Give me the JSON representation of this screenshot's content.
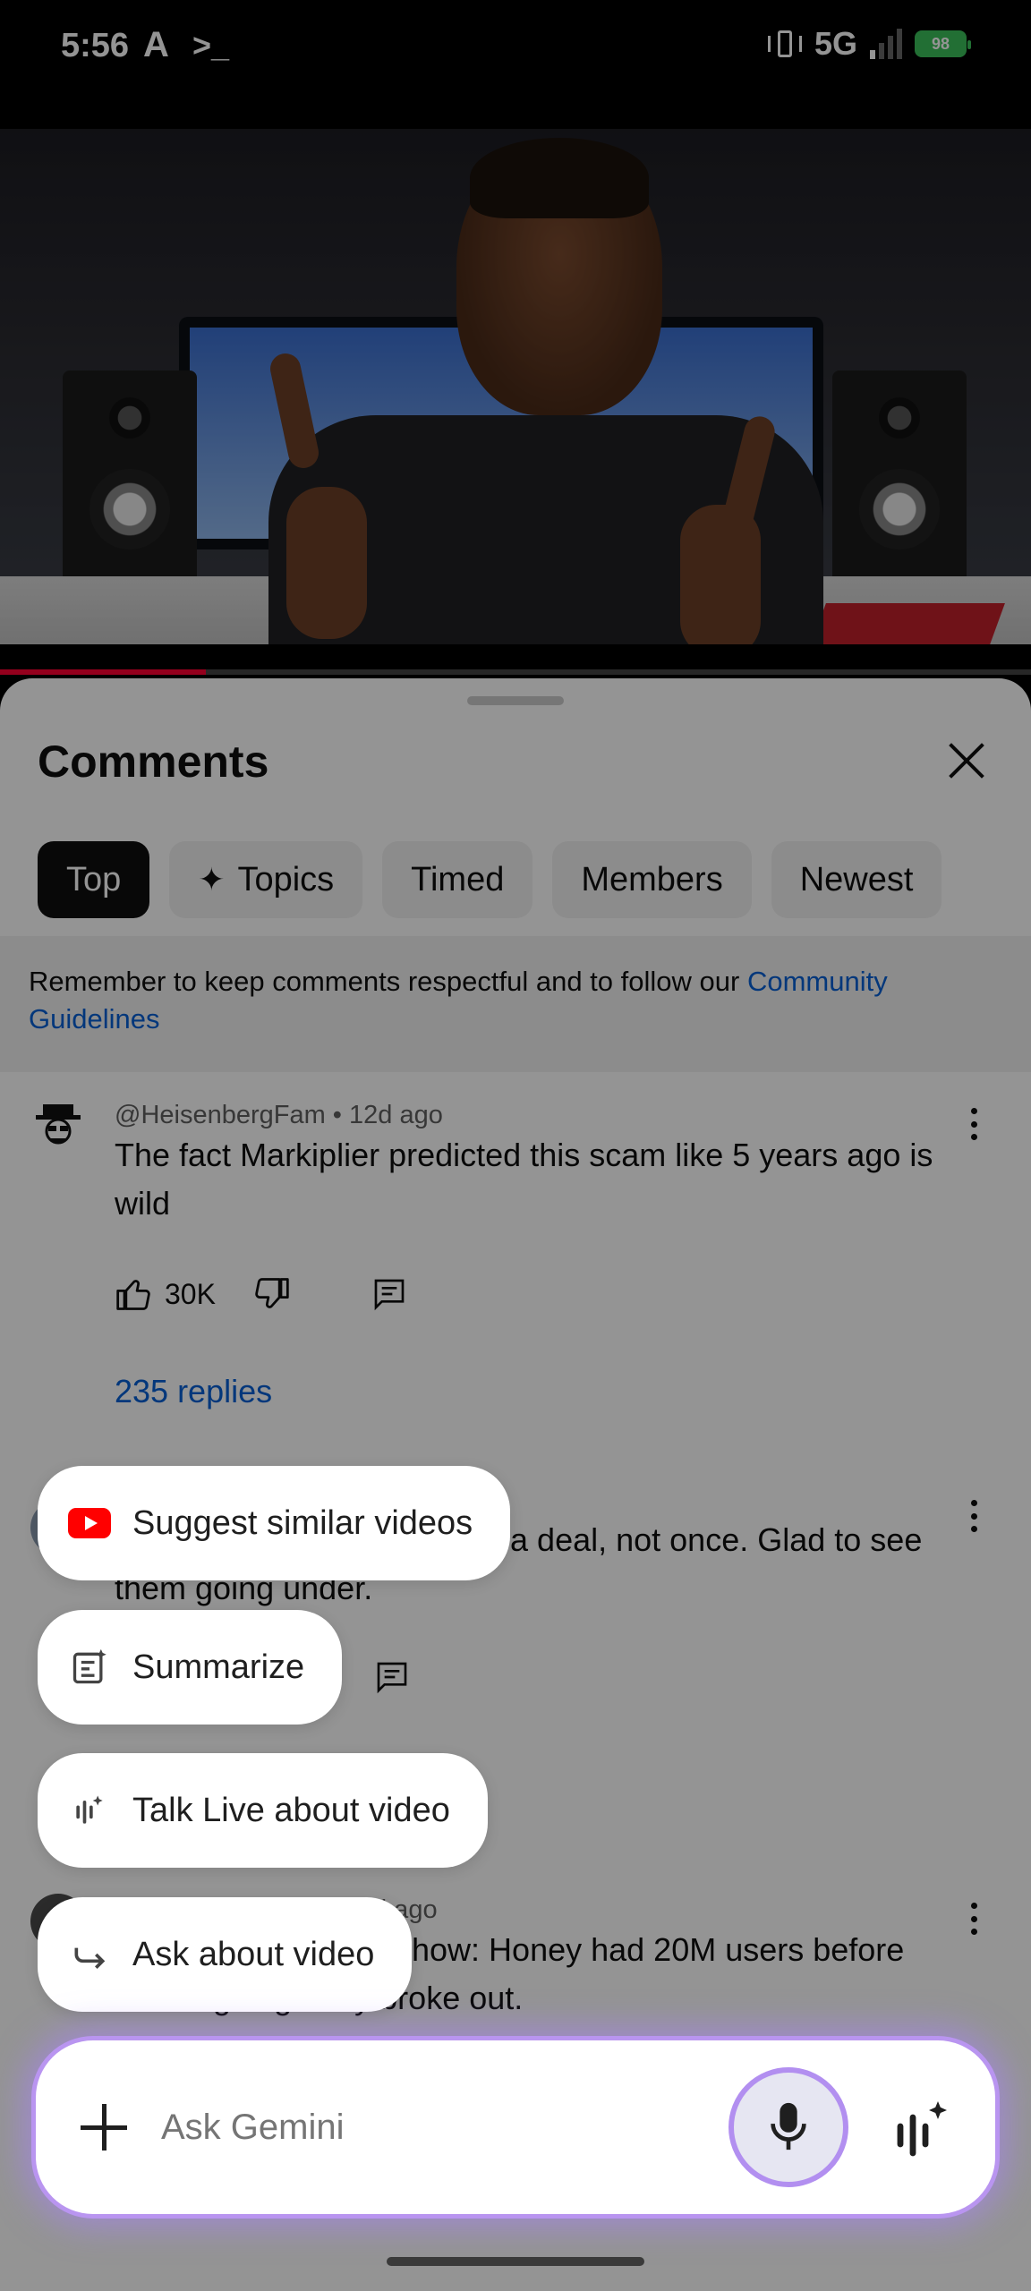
{
  "status_bar": {
    "time": "5:56",
    "network": "5G",
    "battery": "98"
  },
  "video": {
    "progress_fraction": 0.2
  },
  "comments_panel": {
    "title": "Comments",
    "filter_chips": [
      {
        "label": "Top",
        "active": true
      },
      {
        "label": "Topics",
        "active": false,
        "icon": "sparkle-icon"
      },
      {
        "label": "Timed",
        "active": false
      },
      {
        "label": "Members",
        "active": false
      },
      {
        "label": "Newest",
        "active": false
      }
    ],
    "notice": {
      "text": "Remember to keep comments respectful and to follow our ",
      "link": "Community Guidelines"
    },
    "comments": [
      {
        "author": "@HeisenbergFam",
        "age": "12d ago",
        "meta": "@HeisenbergFam • 12d ago",
        "text": "The fact Markiplier predicted this scam like 5 years ago is wild",
        "likes": "30K",
        "replies": "235 replies"
      },
      {
        "text_fragment_1": "e a deal, not once. Glad to see",
        "text_fragment_2": "them going under."
      },
      {
        "meta_fragment": "d ago",
        "text_fragment_1": "how: Honey had 20M users before",
        "text_fragment_2": "the Megalag story broke out."
      }
    ]
  },
  "gemini": {
    "suggestions": [
      {
        "label": "Suggest similar videos",
        "icon": "youtube-icon"
      },
      {
        "label": "Summarize",
        "icon": "summarize-icon"
      },
      {
        "label": "Talk Live about video",
        "icon": "live-icon"
      },
      {
        "label": "Ask about video",
        "icon": "share-arrow-icon"
      }
    ],
    "input_placeholder": "Ask Gemini",
    "accent_color": "#b28ff0"
  }
}
